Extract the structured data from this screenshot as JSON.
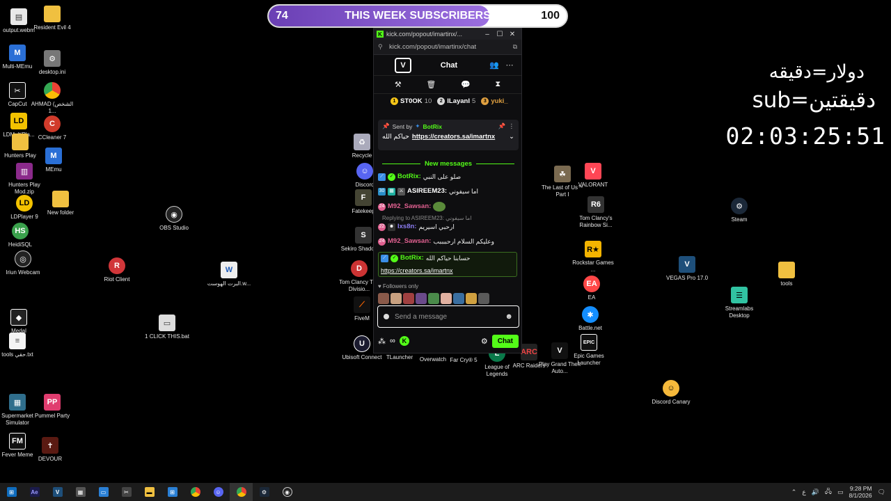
{
  "subscriber_goal": {
    "current": "74",
    "title": "THIS WEEK SUBSCRIBERS",
    "goal": "100",
    "progress_fraction": 0.74,
    "fill_color": "#7d52c8"
  },
  "overlay": {
    "line1": "دولار=دقيقه",
    "line2": "sub=دقيقتين",
    "timer": "02:03:25:51"
  },
  "desktop_icons": {
    "output": "output.webm",
    "resident_evil": "Resident Evil 4",
    "multi_memu": "Multi-MEmu",
    "desktop_ini": "desktop.ini",
    "capcut": "CapCut",
    "ahmad": "AHMAD (الشخص 1...",
    "ldmultiplayer": "LDMultiPla...",
    "ccleaner": "CCleaner 7",
    "hunters_play": "Hunters Play",
    "memu": "MEmu",
    "hunters_play_mod": "Hunters Play Mod.zip",
    "ldplayer9": "LDPlayer 9",
    "new_folder": "New folder",
    "heidisql": "HeidiSQL",
    "obs": "OBS Studio",
    "iriun": "Iriun Webcam",
    "riot": "Riot Client",
    "alburt": "البرت الهوست.w...",
    "medal": "Medal",
    "click_bat": "1 CLICK THIS.bat",
    "tools_txt": "tools حقي.txt",
    "supermarket": "Supermarket Simulator",
    "pummel": "Pummel Party",
    "fever": "Fever Meme",
    "devour": "DEVOUR",
    "recycle": "Recycle",
    "discord": "Discord",
    "fatekeeper": "Fatekeep",
    "sekiro": "Sekiro Shadows...",
    "tom_division": "Tom Clancy The Divisio...",
    "fivem": "FiveM",
    "ubisoft": "Ubisoft Connect",
    "tlauncher": "TLauncher",
    "overwatch": "Overwatch",
    "farcry": "Far Cry® 5",
    "lol": "League of Legends",
    "arc": "ARC Raiders",
    "gta": "Play Grand Theft Auto...",
    "last_of_us": "The Last of Us™ Part I",
    "valorant": "VALORANT",
    "rainbow": "Tom Clancy's Rainbow Si...",
    "rockstar": "Rockstar Games ...",
    "ea": "EA",
    "battlenet": "Battle.net",
    "epic": "Epic Games Launcher",
    "vegas": "VEGAS Pro 17.0",
    "steam": "Steam",
    "streamlabs": "Streamlabs Desktop",
    "tools": "tools",
    "discord_canary": "Discord Canary"
  },
  "popup": {
    "window_title": "kick.com/popout/imartinx/...",
    "address": "kick.com/popout/imartinx/chat",
    "logo": "V",
    "chat_title": "Chat",
    "leaderboard": [
      {
        "name": "ST0OK",
        "count": "10",
        "color": "#f5c518"
      },
      {
        "name": "ILayanI",
        "count": "5",
        "color": "#d9d9d9"
      },
      {
        "name": "yuki_",
        "count": "",
        "color": "#e0a040"
      }
    ],
    "pinned": {
      "sent_by": "Sent by",
      "sender": "BotRix",
      "text": "حياكم الله",
      "link": "https://creators.sa/imartnx"
    },
    "new_messages": "New messages",
    "messages": [
      {
        "user": "BotRix:",
        "color": "#53fc18",
        "text": "صلو على النبي"
      },
      {
        "user": "ASIREEM23:",
        "color": "#ffffff",
        "text": "اما سيفوني"
      },
      {
        "user": "M92_Sawsan:",
        "color": "#e06090",
        "text": ""
      },
      {
        "user": "Ixs8n:",
        "color": "#8b7cf0",
        "text": "ارحبي اسيريم"
      },
      {
        "user": "M92_Sawsan:",
        "color": "#e06090",
        "text": "وعليكم السلام ارحببببب"
      },
      {
        "user": "BotRix:",
        "color": "#53fc18",
        "text": "حسابنا حياكم الله",
        "link": "https://creators.sa/imartnx"
      }
    ],
    "reply_text": "Replying to ASIREEM23: اما سيفوني",
    "followers_only": "Followers only",
    "input_placeholder": "Send a message",
    "chat_button": "Chat"
  },
  "taskbar": {
    "time": "9:28 PM",
    "date": "8/1/2026",
    "lang": "ع"
  }
}
